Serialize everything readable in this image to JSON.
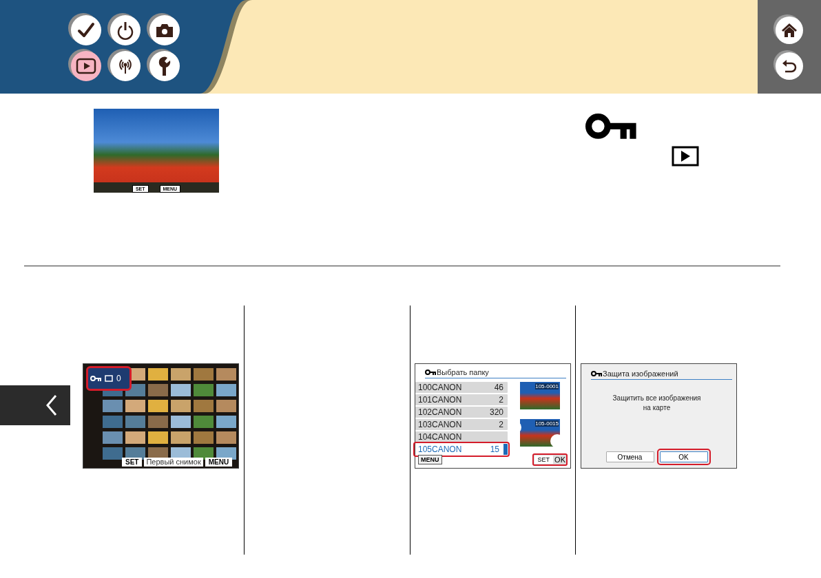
{
  "chapters": [
    {
      "kind": "check",
      "selected": false
    },
    {
      "kind": "power",
      "selected": false
    },
    {
      "kind": "camera",
      "selected": false
    },
    {
      "kind": "play",
      "selected": true
    },
    {
      "kind": "wireless",
      "selected": false
    },
    {
      "kind": "wrench",
      "selected": false
    }
  ],
  "nav_buttons": [
    {
      "kind": "home"
    },
    {
      "kind": "back"
    }
  ],
  "preview": {
    "set": "SET",
    "menu": "MENU"
  },
  "grid_screen": {
    "count": "0",
    "set": "SET",
    "set_label": "Первый снимок",
    "menu": "MENU"
  },
  "folder_screen": {
    "title": "Выбрать папку",
    "rows": [
      {
        "name": "100CANON",
        "count": "46",
        "selected": false
      },
      {
        "name": "101CANON",
        "count": "2",
        "selected": false
      },
      {
        "name": "102CANON",
        "count": "320",
        "selected": false
      },
      {
        "name": "103CANON",
        "count": "2",
        "selected": false
      },
      {
        "name": "104CANON",
        "selected": false
      },
      {
        "name": "105CANON",
        "count": "15",
        "selected": true
      }
    ],
    "thumbs": [
      "105-0001",
      "105-0015"
    ],
    "menu": "MENU",
    "set": "SET",
    "ok": "OK"
  },
  "dialog_screen": {
    "title": "Защита изображений",
    "message": [
      "Защитить все изображения",
      "на карте"
    ],
    "buttons": [
      {
        "label": "Отмена",
        "selected": false
      },
      {
        "label": "OK",
        "selected": true
      }
    ]
  }
}
